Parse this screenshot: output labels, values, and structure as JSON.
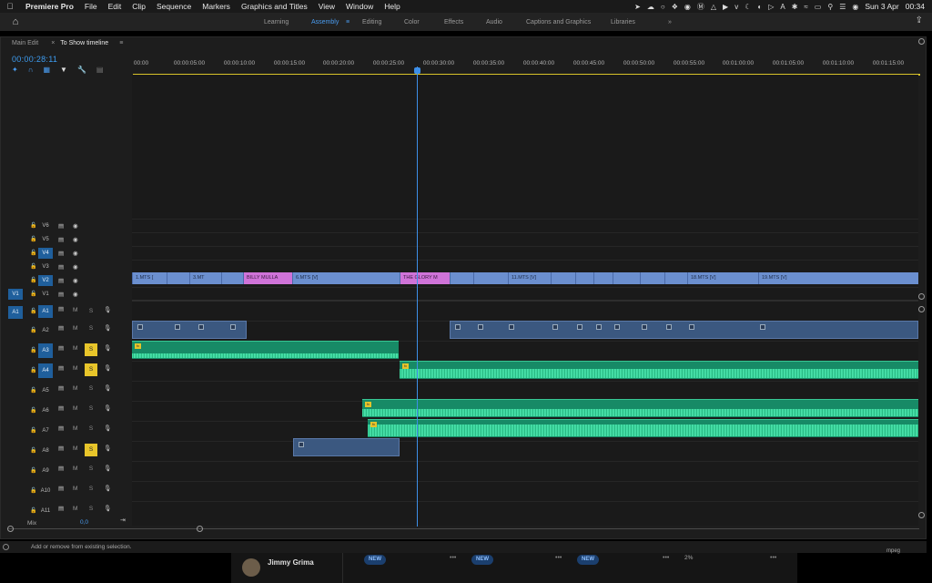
{
  "menubar": {
    "app_name": "Premiere Pro",
    "menus": [
      "File",
      "Edit",
      "Clip",
      "Sequence",
      "Markers",
      "Graphics and Titles",
      "View",
      "Window",
      "Help"
    ],
    "status_icons": [
      "location-icon",
      "cloud-icon",
      "creative-cloud-icon",
      "dropbox-icon",
      "eye-icon",
      "m-icon",
      "drive-icon",
      "play-icon",
      "vimeo-icon",
      "moon-icon",
      "moon2-icon",
      "play-circle-icon",
      "a-icon",
      "bluetooth-icon",
      "bluetooth-icon",
      "wifi-icon",
      "battery-icon",
      "search-icon",
      "control-center-icon",
      "siri-icon"
    ],
    "date": "Sun 3 Apr",
    "time": "00:34"
  },
  "workspace": {
    "tabs": [
      {
        "label": "Learning",
        "active": false
      },
      {
        "label": "Assembly",
        "active": true
      },
      {
        "label": "Editing",
        "active": false
      },
      {
        "label": "Color",
        "active": false
      },
      {
        "label": "Effects",
        "active": false
      },
      {
        "label": "Audio",
        "active": false
      },
      {
        "label": "Captions and Graphics",
        "active": false
      },
      {
        "label": "Libraries",
        "active": false
      }
    ],
    "overflow": "»"
  },
  "timeline": {
    "tabs": [
      {
        "label": "Main Edit",
        "active": false
      },
      {
        "label": "To Show timeline",
        "active": true
      }
    ],
    "timecode": "00:00:28:11",
    "ruler_ticks": [
      "00:00",
      "00:00:05:00",
      "00:00:10:00",
      "00:00:15:00",
      "00:00:20:00",
      "00:00:25:00",
      "00:00:30:00",
      "00:00:35:00",
      "00:00:40:00",
      "00:00:45:00",
      "00:00:50:00",
      "00:00:55:00",
      "00:01:00:00",
      "00:01:05:00",
      "00:01:10:00",
      "00:01:15:00"
    ],
    "video_tracks": [
      "V6",
      "V5",
      "V4",
      "V3",
      "V2",
      "V1"
    ],
    "audio_tracks": [
      "A1",
      "A2",
      "A3",
      "A4",
      "A5",
      "A6",
      "A7",
      "A8",
      "A9",
      "A10",
      "A11"
    ],
    "source_v": "V1",
    "source_a": "A1",
    "mute_label": "M",
    "solo_label": "S",
    "solo_on": [
      "A3",
      "A4",
      "A8"
    ],
    "video_clips": [
      {
        "label": "1.MTS [",
        "color": "blue"
      },
      {
        "label": "",
        "color": "blue"
      },
      {
        "label": "3.MT",
        "color": "blue"
      },
      {
        "label": "",
        "color": "blue"
      },
      {
        "label": "BILLY MULLA",
        "color": "pink"
      },
      {
        "label": "6.MTS [V]",
        "color": "blue"
      },
      {
        "label": "THE GLORY M",
        "color": "pink"
      },
      {
        "label": "",
        "color": "blue"
      },
      {
        "label": "",
        "color": "blue"
      },
      {
        "label": "11.MTS [V]",
        "color": "blue"
      },
      {
        "label": "",
        "color": "blue"
      },
      {
        "label": "",
        "color": "blue"
      },
      {
        "label": "",
        "color": "blue"
      },
      {
        "label": "",
        "color": "blue"
      },
      {
        "label": "",
        "color": "blue"
      },
      {
        "label": "",
        "color": "blue"
      },
      {
        "label": "18.MTS [V]",
        "color": "blue"
      },
      {
        "label": "19.MTS [V]",
        "color": "blue"
      }
    ],
    "mix_label": "Mix",
    "mix_value": "0,0"
  },
  "status_bar": {
    "message": "Add or remove from existing selection."
  },
  "background_app": {
    "user_name": "Jimmy Grima",
    "badges": [
      "NEW",
      "NEW",
      "NEW"
    ],
    "percent": "2%",
    "file_label": "mpeg"
  }
}
